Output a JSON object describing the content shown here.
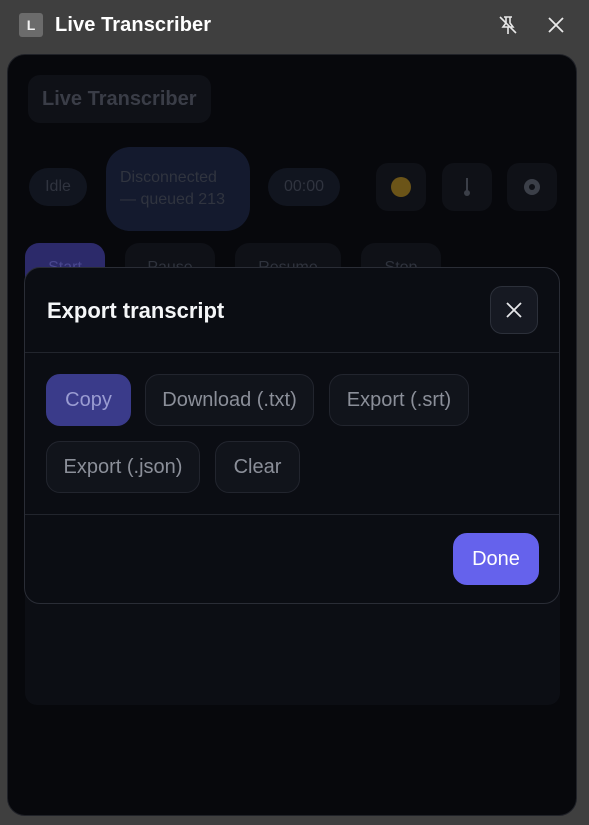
{
  "window": {
    "app_icon_letter": "L",
    "title": "Live Transcriber",
    "pin_icon": "unpin-icon",
    "close_icon": "close-icon"
  },
  "background": {
    "header_title": "Live Transcriber",
    "status": "Idle",
    "connection": "Disconnected — queued 213",
    "timer": "00:00",
    "tabs": [
      "Start",
      "Pause",
      "Resume",
      "Stop"
    ]
  },
  "modal": {
    "title": "Export transcript",
    "close_icon": "close-icon",
    "actions": {
      "copy": "Copy",
      "download_txt": "Download (.txt)",
      "export_srt": "Export (.srt)",
      "export_json": "Export (.json)",
      "clear": "Clear"
    },
    "done": "Done"
  },
  "colors": {
    "accent": "#6562ec",
    "modal_bg": "#0b0d13",
    "window_chrome": "#3f3f3f"
  }
}
